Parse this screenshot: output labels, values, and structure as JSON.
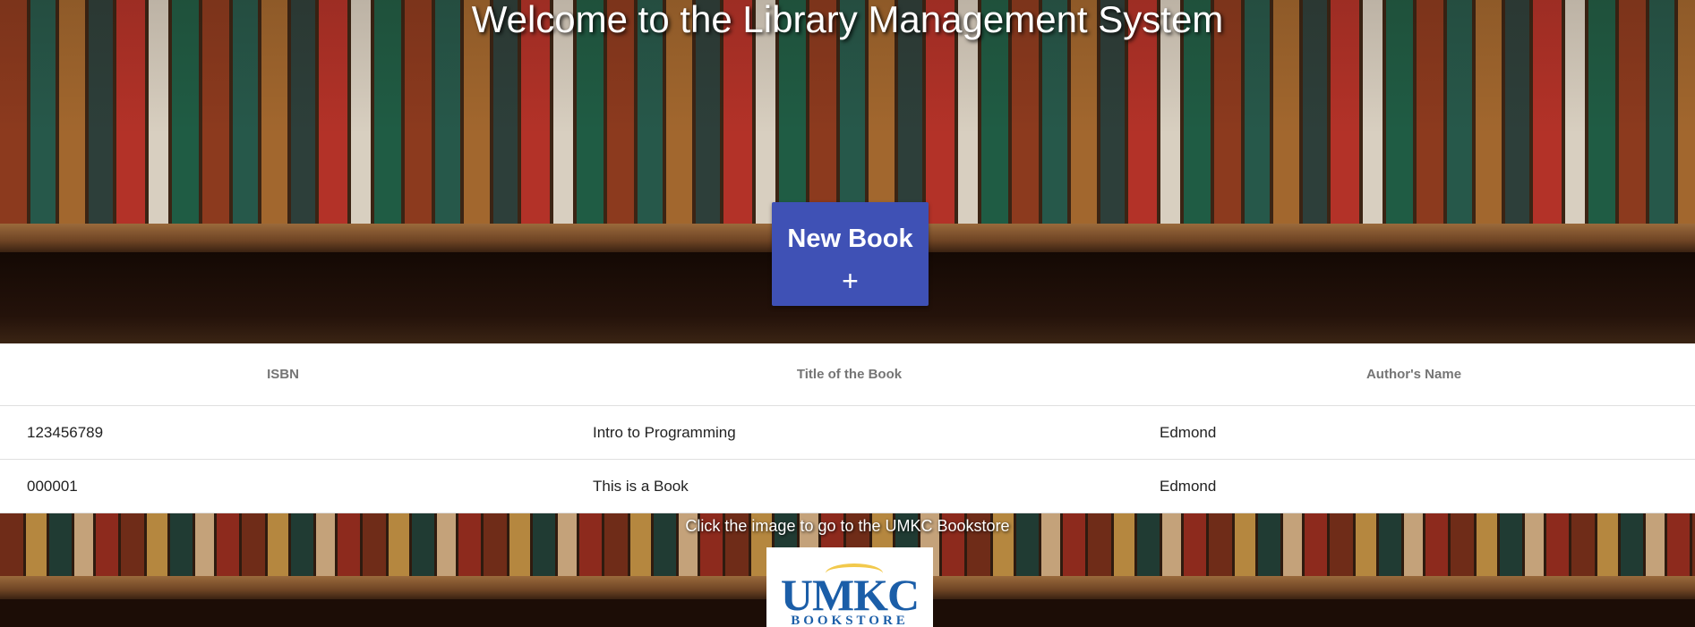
{
  "header": {
    "title": "Welcome to the Library Management System"
  },
  "actions": {
    "new_book_label": "New Book",
    "new_book_icon": "plus-icon",
    "new_book_glyph": "+",
    "button_color": "#3f51b5"
  },
  "table": {
    "columns": [
      "ISBN",
      "Title of the Book",
      "Author's Name"
    ],
    "rows": [
      {
        "isbn": "123456789",
        "title": "Intro to Programming",
        "author": "Edmond"
      },
      {
        "isbn": "000001",
        "title": "This is a Book",
        "author": "Edmond"
      }
    ]
  },
  "footer": {
    "caption": "Click the image to go to the UMKC Bookstore",
    "logo_text": "UMKC",
    "logo_subtext": "BOOKSTORE"
  }
}
